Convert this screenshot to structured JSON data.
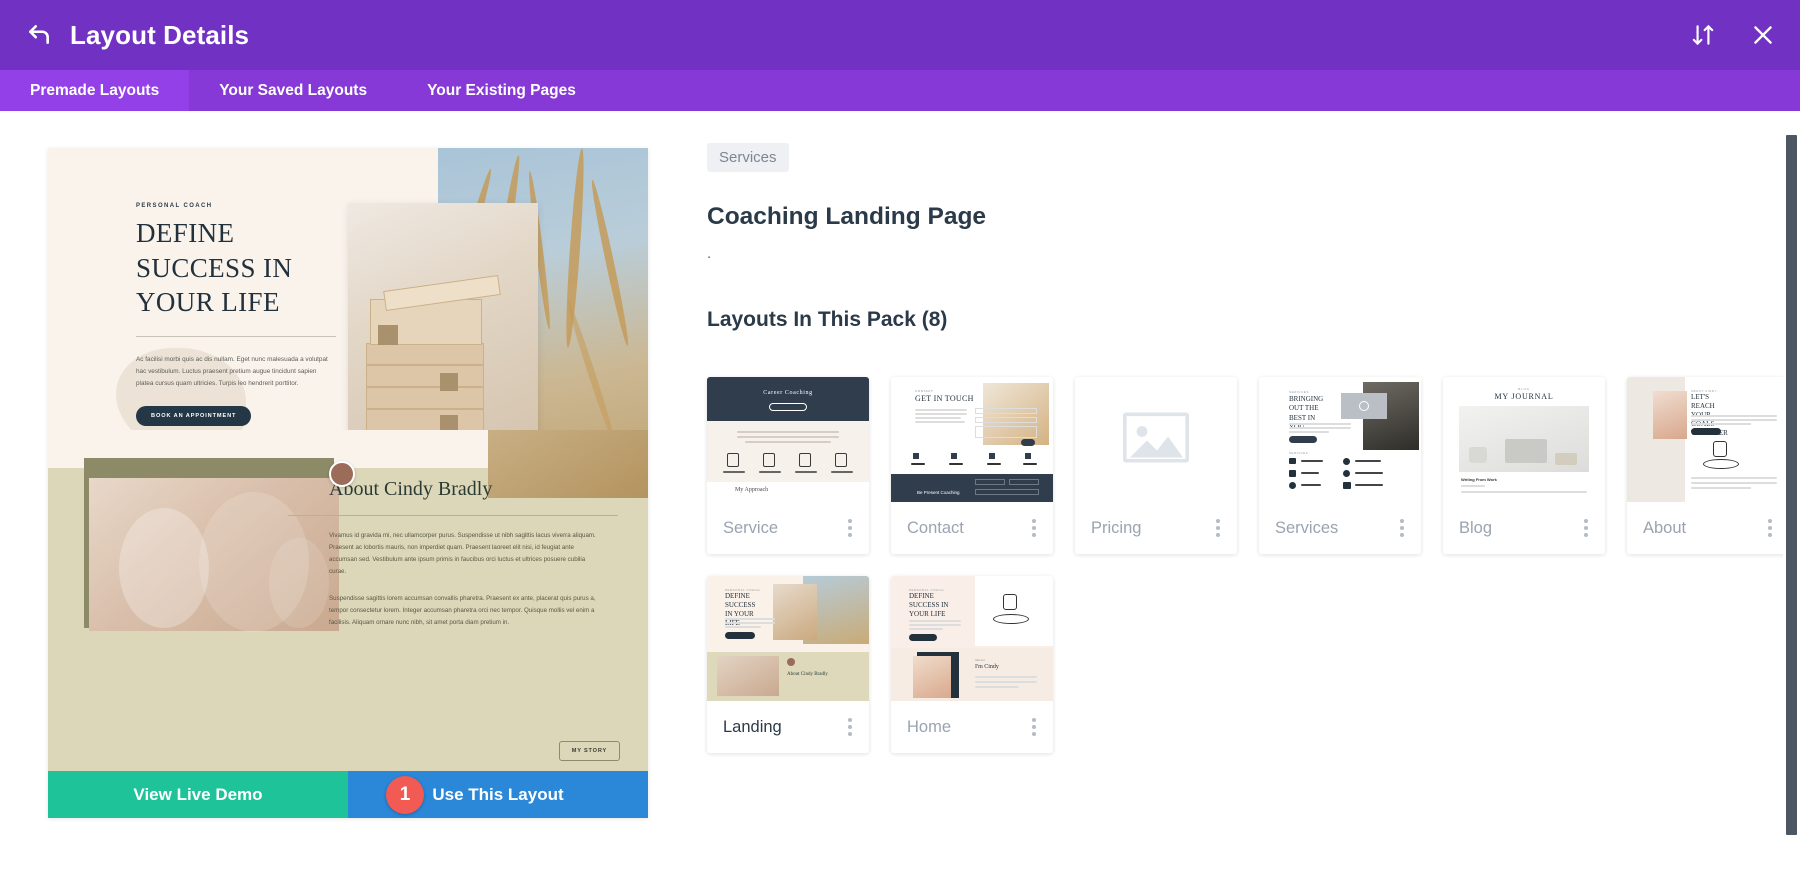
{
  "topbar": {
    "title": "Layout Details",
    "back_icon": "back-arrow-icon",
    "sort_icon": "sort-updown-icon",
    "close_icon": "close-icon",
    "bg": "#7131c2"
  },
  "tabs": [
    {
      "label": "Premade Layouts",
      "active": true
    },
    {
      "label": "Your Saved Layouts",
      "active": false
    },
    {
      "label": "Your Existing Pages",
      "active": false
    }
  ],
  "preview": {
    "hero": {
      "kicker": "PERSONAL COACH",
      "heading": "DEFINE SUCCESS IN YOUR LIFE",
      "paragraph": "Ac facilisi morbi quis ac dis nullam. Eget nunc malesuada a volutpat hac vestibulum. Luctus praesent pretium augue tincidunt sapien platea cursus quam ultricies. Turpis leo hendrerit porttitor.",
      "button": "BOOK AN APPOINTMENT"
    },
    "about": {
      "heading": "About Cindy Bradly",
      "paragraph1": "Vivamus id gravida mi, nec ullamcorper purus. Suspendisse ut nibh sagittis lacus viverra aliquam. Praesent ac lobortis mauris, non imperdiet quam. Praesent laoreet elit nisi, id feugiat ante accumsan sed. Vestibulum ante ipsum primis in faucibus orci luctus et ultrices posuere cubilia curae.",
      "paragraph2": "Suspendisse sagittis lorem accumsan convallis pharetra. Praesent ex ante, placerat quis purus a, tempor consectetur lorem. Integer accumsan pharetra orci nec tempor. Quisque mollis vel enim a facilisis. Aliquam ornare nunc nibh, sit amet porta diam pretium in.",
      "button": "MY STORY"
    },
    "actions": {
      "demo_label": "View Live Demo",
      "use_label": "Use This Layout",
      "step_number": "1",
      "demo_color": "#1ec39a",
      "use_color": "#2b87d8",
      "badge_color": "#f15b54"
    }
  },
  "details": {
    "category": "Services",
    "title": "Coaching Landing Page",
    "description": ".",
    "pack_heading": "Layouts In This Pack (8)"
  },
  "layouts": [
    {
      "label": "Service",
      "thumb": "service-thumb",
      "active": false,
      "thumb_title": "Career Coaching",
      "thumb_sub": "My Approach"
    },
    {
      "label": "Contact",
      "thumb": "contact-thumb",
      "active": false,
      "thumb_title": "GET IN TOUCH",
      "thumb_sub": "Be Present Coaching"
    },
    {
      "label": "Pricing",
      "thumb": "placeholder",
      "active": false,
      "thumb_title": "",
      "thumb_sub": ""
    },
    {
      "label": "Services",
      "thumb": "services-thumb",
      "active": false,
      "thumb_title": "BRINGING OUT THE BEST IN YOU",
      "thumb_sub": ""
    },
    {
      "label": "Blog",
      "thumb": "blog-thumb",
      "active": false,
      "thumb_title": "MY JOURNAL",
      "thumb_sub": "Writing From Work"
    },
    {
      "label": "About",
      "thumb": "about-thumb",
      "active": false,
      "thumb_title": "LET'S REACH YOUR GOALS TOGETHER",
      "thumb_sub": ""
    },
    {
      "label": "Landing",
      "thumb": "landing-thumb",
      "active": true,
      "thumb_title": "DEFINE SUCCESS IN YOUR LIFE",
      "thumb_sub": "About Cindy Bradly"
    },
    {
      "label": "Home",
      "thumb": "home-thumb",
      "active": false,
      "thumb_title": "DEFINE SUCCESS IN YOUR LIFE",
      "thumb_sub": "I'm Cindy"
    }
  ],
  "scrollbar": {
    "name": "vertical-scrollbar",
    "color": "#4d5762"
  }
}
